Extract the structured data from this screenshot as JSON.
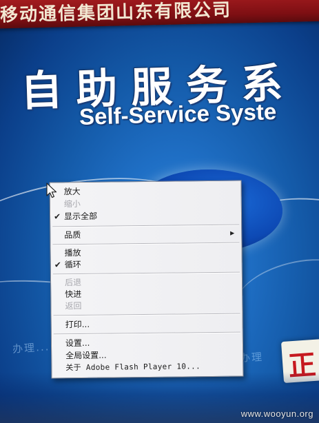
{
  "background": {
    "top_banner_text": "移动通信集团山东有限公司",
    "title_cn": "自助服务系",
    "title_en": "Self-Service Syste",
    "faint_left": "办理...",
    "faint_right": "办理",
    "corner_glyph": "正"
  },
  "context_menu": {
    "items": [
      {
        "label": "放大",
        "enabled": true,
        "checked": false
      },
      {
        "label": "缩小",
        "enabled": false,
        "checked": false
      },
      {
        "label": "显示全部",
        "enabled": true,
        "checked": true
      },
      {
        "label": "品质",
        "enabled": true,
        "checked": false,
        "submenu": true
      },
      {
        "label": "播放",
        "enabled": true,
        "checked": false
      },
      {
        "label": "循环",
        "enabled": true,
        "checked": true
      },
      {
        "label": "后退",
        "enabled": false,
        "checked": false
      },
      {
        "label": "快进",
        "enabled": true,
        "checked": false
      },
      {
        "label": "返回",
        "enabled": false,
        "checked": false
      },
      {
        "label": "打印...",
        "enabled": true,
        "checked": false
      },
      {
        "label": "设置...",
        "enabled": true,
        "checked": false
      },
      {
        "label": "全局设置...",
        "enabled": true,
        "checked": false
      },
      {
        "label": "关于 Adobe Flash Player 10...",
        "enabled": true,
        "checked": false
      }
    ],
    "check_glyph": "✔",
    "submenu_glyph": "▶"
  },
  "watermark": "www.wooyun.org",
  "colors": {
    "background_blue": "#145aa8",
    "menu_bg": "#f2f2f4",
    "banner_red": "#8e1418",
    "disabled_text": "#a7a7ad"
  },
  "icons": {
    "cursor": "arrow-cursor-icon",
    "check": "checkmark-icon",
    "submenu": "submenu-arrow-icon"
  }
}
